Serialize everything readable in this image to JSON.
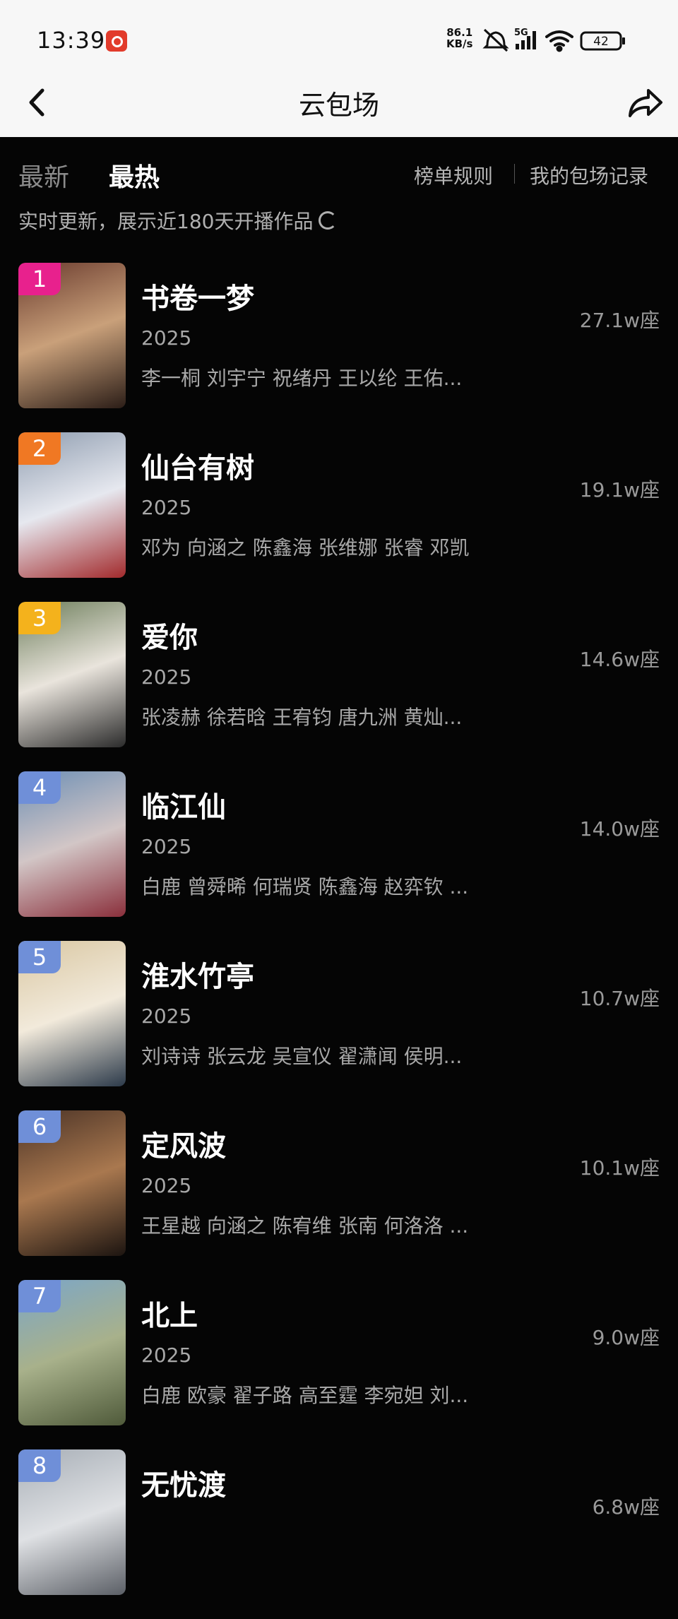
{
  "status": {
    "time": "13:39",
    "speed_top": "86.1",
    "speed_unit": "KB/s",
    "network": "5G",
    "battery": "42"
  },
  "header": {
    "title": "云包场"
  },
  "tabs": {
    "latest": "最新",
    "hottest": "最热",
    "rules": "榜单规则",
    "records": "我的包场记录"
  },
  "subtitle": "实时更新，展示近180天开播作品",
  "items": [
    {
      "rank": "1",
      "name": "书卷一梦",
      "year": "2025",
      "cast": "李一桐 刘宇宁 祝绪丹 王以纶 王佑...",
      "seats": "27.1w座",
      "badge": "#e8218d",
      "poster": [
        "#6a3b2e",
        "#c9a07a",
        "#2b1d17"
      ]
    },
    {
      "rank": "2",
      "name": "仙台有树",
      "year": "2025",
      "cast": "邓为 向涵之 陈鑫海 张维娜 张睿 邓凯",
      "seats": "19.1w座",
      "badge": "#f07823",
      "poster": [
        "#8f9db0",
        "#e6e8ef",
        "#a22a2c"
      ]
    },
    {
      "rank": "3",
      "name": "爱你",
      "year": "2025",
      "cast": "张凌赫 徐若晗 王宥钧 唐九洲 黄灿...",
      "seats": "14.6w座",
      "badge": "#f4b21c",
      "poster": [
        "#6c7d5a",
        "#e9e4dc",
        "#2b2b2b"
      ]
    },
    {
      "rank": "4",
      "name": "临江仙",
      "year": "2025",
      "cast": "白鹿 曾舜晞 何瑞贤 陈鑫海 赵弈钦 ...",
      "seats": "14.0w座",
      "badge": "#6f8fd8",
      "poster": [
        "#6d8fb4",
        "#d2c6c6",
        "#8a2f3b"
      ]
    },
    {
      "rank": "5",
      "name": "淮水竹亭",
      "year": "2025",
      "cast": "刘诗诗 张云龙 吴宣仪 翟潇闻 侯明...",
      "seats": "10.7w座",
      "badge": "#6f8fd8",
      "poster": [
        "#d9c7a2",
        "#f2eadb",
        "#2c3a4a"
      ]
    },
    {
      "rank": "6",
      "name": "定风波",
      "year": "2025",
      "cast": "王星越 向涵之 陈宥维 张南 何洛洛 ...",
      "seats": "10.1w座",
      "badge": "#6f8fd8",
      "poster": [
        "#4b3326",
        "#a9784f",
        "#1c1410"
      ]
    },
    {
      "rank": "7",
      "name": "北上",
      "year": "2025",
      "cast": "白鹿 欧豪 翟子路 高至霆 李宛妲 刘...",
      "seats": "9.0w座",
      "badge": "#6f8fd8",
      "poster": [
        "#7ba6c8",
        "#a8b18b",
        "#4f5a3a"
      ]
    },
    {
      "rank": "8",
      "name": "无忧渡",
      "year": "",
      "cast": "",
      "seats": "6.8w座",
      "badge": "#6f8fd8",
      "poster": [
        "#a7aeb6",
        "#dfe1e4",
        "#5b5f66"
      ]
    }
  ]
}
